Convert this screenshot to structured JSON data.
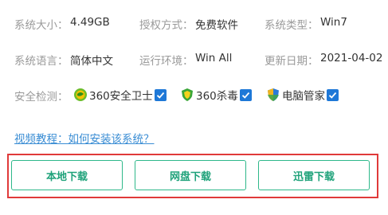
{
  "info_rows": [
    [
      {
        "label": "系统大小：",
        "value": "4.49GB"
      },
      {
        "label": "授权方式：",
        "value": "免费软件"
      },
      {
        "label": "系统类型：",
        "value": "Win7"
      }
    ],
    [
      {
        "label": "系统语言：",
        "value": "简体中文"
      },
      {
        "label": "运行环境：",
        "value": "Win All"
      },
      {
        "label": "更新日期：",
        "value": "2021-04-02"
      }
    ]
  ],
  "security": {
    "label": "安全检测：",
    "items": [
      {
        "name": "360安全卫士",
        "icon": "360-safeguard-icon",
        "checked": true
      },
      {
        "name": "360杀毒",
        "icon": "360-antivirus-icon",
        "checked": true
      },
      {
        "name": "电脑管家",
        "icon": "pc-manager-icon",
        "checked": true
      }
    ]
  },
  "tutorial_link": "视频教程：如何安装该系统？",
  "downloads": {
    "local": "本地下载",
    "netdisk": "网盘下载",
    "thunder": "迅雷下载"
  },
  "colors": {
    "label": "#9a9a9a",
    "value": "#333333",
    "link": "#3a8dd4",
    "button_text": "#1fa27a",
    "button_border": "#2eb88a",
    "highlight_box": "#e03a3a",
    "checkbox": "#1e78d7"
  }
}
